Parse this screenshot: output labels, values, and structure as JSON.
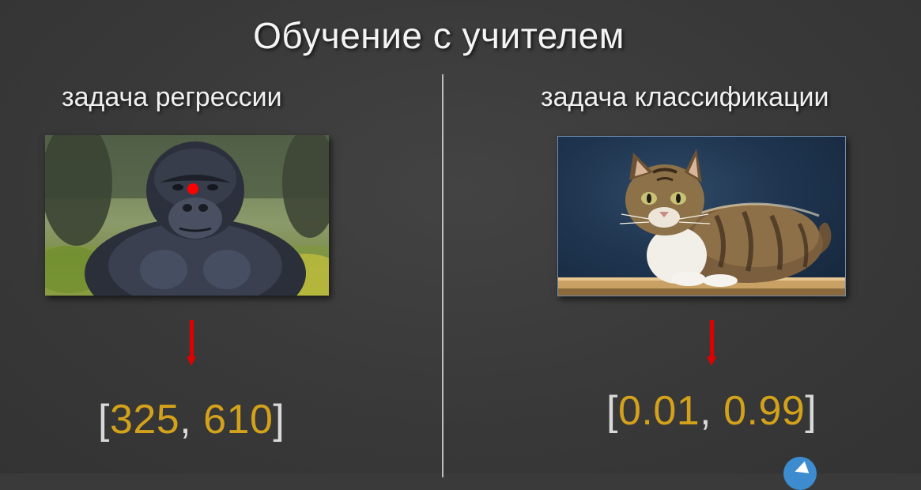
{
  "slide": {
    "title": "Обучение с учителем",
    "left": {
      "heading": "задача регрессии",
      "image": "gorilla-photo",
      "marker_color": "#ff0000",
      "arrow_color": "#e00000",
      "output": {
        "open": "[",
        "first": "325",
        "separator": ", ",
        "second": "610",
        "close": "]"
      }
    },
    "right": {
      "heading": "задача классификации",
      "image": "kitten-photo",
      "arrow_color": "#e00000",
      "output": {
        "open": "[",
        "first": "0.01",
        "separator": ", ",
        "second": "0.99",
        "close": "]"
      }
    },
    "colors": {
      "background": "#3a3a3a",
      "number": "#d4a21a",
      "bracket": "#d9d9d9",
      "text": "#f0f0f0"
    },
    "corner_icon": "telegram-icon"
  }
}
